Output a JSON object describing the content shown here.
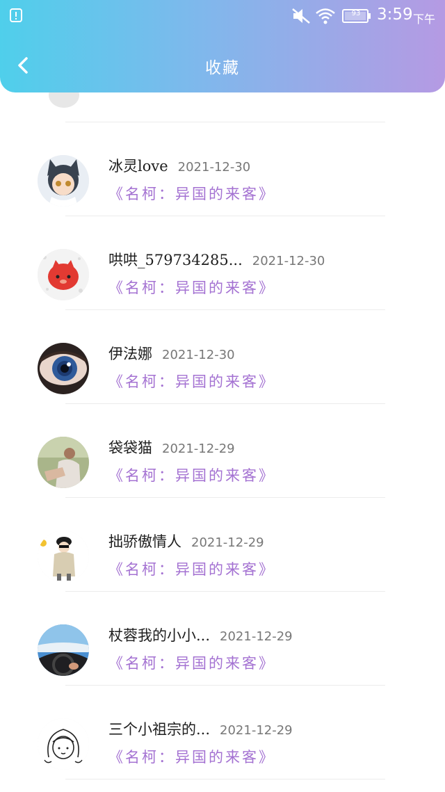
{
  "status_bar": {
    "battery": "93",
    "time": "3:59",
    "ampm": "下午",
    "icons": [
      "alert-icon",
      "mute-icon",
      "wifi-icon",
      "battery-icon"
    ]
  },
  "header": {
    "title": "收藏",
    "back_icon": "chevron-left-icon",
    "gradient": [
      "#4fcfeb",
      "#b59ae3"
    ]
  },
  "favorites": [
    {
      "name": "冰灵love",
      "date": "2021-12-30",
      "book": "《名柯：异国的来客》"
    },
    {
      "name": "哄哄_579734285...",
      "date": "2021-12-30",
      "book": "《名柯：异国的来客》"
    },
    {
      "name": "伊法娜",
      "date": "2021-12-30",
      "book": "《名柯：异国的来客》"
    },
    {
      "name": "袋袋猫",
      "date": "2021-12-29",
      "book": "《名柯：异国的来客》"
    },
    {
      "name": "拙骄傲情人",
      "date": "2021-12-29",
      "book": "《名柯：异国的来客》"
    },
    {
      "name": "杖蓉我的小小...",
      "date": "2021-12-29",
      "book": "《名柯：异国的来客》"
    },
    {
      "name": "三个小祖宗的...",
      "date": "2021-12-29",
      "book": "《名柯：异国的来客》"
    }
  ],
  "colors": {
    "book_title": "#a472d2",
    "name": "#1e1e1e",
    "date": "#777777"
  }
}
